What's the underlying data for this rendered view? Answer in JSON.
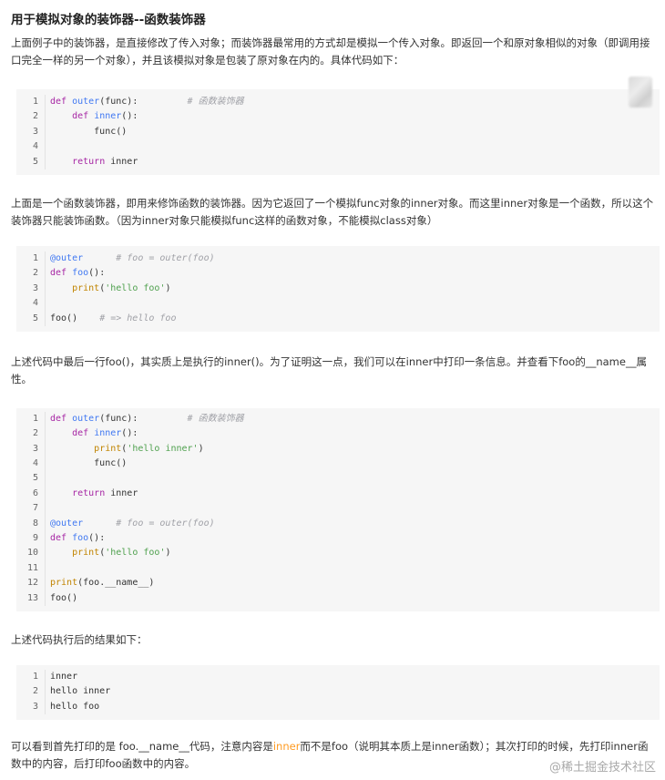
{
  "title": "用于模拟对象的装饰器--函数装饰器",
  "para1": "上面例子中的装饰器，是直接修改了传入对象；而装饰器最常用的方式却是模拟一个传入对象。即返回一个和原对象相似的对象（即调用接口完全一样的另一个对象），并且该模拟对象是包装了原对象在内的。具体代码如下：",
  "para2": "上面是一个函数装饰器，即用来修饰函数的装饰器。因为它返回了一个模拟func对象的inner对象。而这里inner对象是一个函数，所以这个装饰器只能装饰函数。（因为inner对象只能模拟func这样的函数对象，不能模拟class对象）",
  "para3": "上述代码中最后一行foo()，其实质上是执行的inner()。为了证明这一点，我们可以在inner中打印一条信息。并查看下foo的__name__属性。",
  "para4": "上述代码执行后的结果如下：",
  "para5_a": "可以看到首先打印的是 foo.__name__代码，注意内容是",
  "para5_hl": "inner",
  "para5_b": "而不是foo（说明其本质上是inner函数）；其次打印的时候，先打印inner函数中的内容，后打印foo函数中的内容。",
  "watermark": "@稀土掘金技术社区",
  "code1": [
    {
      "n": "1",
      "tokens": [
        [
          "kw",
          "def "
        ],
        [
          "fn",
          "outer"
        ],
        [
          "",
          "(func):         "
        ],
        [
          "cm",
          "# 函数装饰器"
        ]
      ]
    },
    {
      "n": "2",
      "tokens": [
        [
          "",
          "    "
        ],
        [
          "kw",
          "def "
        ],
        [
          "fn",
          "inner"
        ],
        [
          "",
          "():"
        ]
      ]
    },
    {
      "n": "3",
      "tokens": [
        [
          "",
          "        func()"
        ]
      ]
    },
    {
      "n": "4",
      "tokens": [
        [
          "",
          ""
        ]
      ]
    },
    {
      "n": "5",
      "tokens": [
        [
          "",
          "    "
        ],
        [
          "kw",
          "return"
        ],
        [
          "",
          " inner"
        ]
      ]
    }
  ],
  "code2": [
    {
      "n": "1",
      "tokens": [
        [
          "dc",
          "@outer"
        ],
        [
          "",
          "      "
        ],
        [
          "cm",
          "# foo = outer(foo)"
        ]
      ]
    },
    {
      "n": "2",
      "tokens": [
        [
          "kw",
          "def "
        ],
        [
          "fn",
          "foo"
        ],
        [
          "",
          "():"
        ]
      ]
    },
    {
      "n": "3",
      "tokens": [
        [
          "",
          "    "
        ],
        [
          "bi",
          "print"
        ],
        [
          "",
          "("
        ],
        [
          "st",
          "'hello foo'"
        ],
        [
          "",
          ")"
        ]
      ]
    },
    {
      "n": "4",
      "tokens": [
        [
          "",
          ""
        ]
      ]
    },
    {
      "n": "5",
      "tokens": [
        [
          "",
          "foo()    "
        ],
        [
          "cm",
          "# => hello foo"
        ]
      ]
    }
  ],
  "code3": [
    {
      "n": "1",
      "tokens": [
        [
          "kw",
          "def "
        ],
        [
          "fn",
          "outer"
        ],
        [
          "",
          "(func):         "
        ],
        [
          "cm",
          "# 函数装饰器"
        ]
      ]
    },
    {
      "n": "2",
      "tokens": [
        [
          "",
          "    "
        ],
        [
          "kw",
          "def "
        ],
        [
          "fn",
          "inner"
        ],
        [
          "",
          "():"
        ]
      ]
    },
    {
      "n": "3",
      "tokens": [
        [
          "",
          "        "
        ],
        [
          "bi",
          "print"
        ],
        [
          "",
          "("
        ],
        [
          "st",
          "'hello inner'"
        ],
        [
          "",
          ")"
        ]
      ]
    },
    {
      "n": "4",
      "tokens": [
        [
          "",
          "        func()"
        ]
      ]
    },
    {
      "n": "5",
      "tokens": [
        [
          "",
          ""
        ]
      ]
    },
    {
      "n": "6",
      "tokens": [
        [
          "",
          "    "
        ],
        [
          "kw",
          "return"
        ],
        [
          "",
          " inner"
        ]
      ]
    },
    {
      "n": "7",
      "tokens": [
        [
          "",
          ""
        ]
      ]
    },
    {
      "n": "8",
      "tokens": [
        [
          "dc",
          "@outer"
        ],
        [
          "",
          "      "
        ],
        [
          "cm",
          "# foo = outer(foo)"
        ]
      ]
    },
    {
      "n": "9",
      "tokens": [
        [
          "kw",
          "def "
        ],
        [
          "fn",
          "foo"
        ],
        [
          "",
          "():"
        ]
      ]
    },
    {
      "n": "10",
      "tokens": [
        [
          "",
          "    "
        ],
        [
          "bi",
          "print"
        ],
        [
          "",
          "("
        ],
        [
          "st",
          "'hello foo'"
        ],
        [
          "",
          ")"
        ]
      ]
    },
    {
      "n": "11",
      "tokens": [
        [
          "",
          ""
        ]
      ]
    },
    {
      "n": "12",
      "tokens": [
        [
          "bi",
          "print"
        ],
        [
          "",
          "(foo.__name__)"
        ]
      ]
    },
    {
      "n": "13",
      "tokens": [
        [
          "",
          "foo()"
        ]
      ]
    }
  ],
  "code4": [
    {
      "n": "1",
      "tokens": [
        [
          "",
          "inner"
        ]
      ]
    },
    {
      "n": "2",
      "tokens": [
        [
          "",
          "hello inner"
        ]
      ]
    },
    {
      "n": "3",
      "tokens": [
        [
          "",
          "hello foo"
        ]
      ]
    }
  ]
}
